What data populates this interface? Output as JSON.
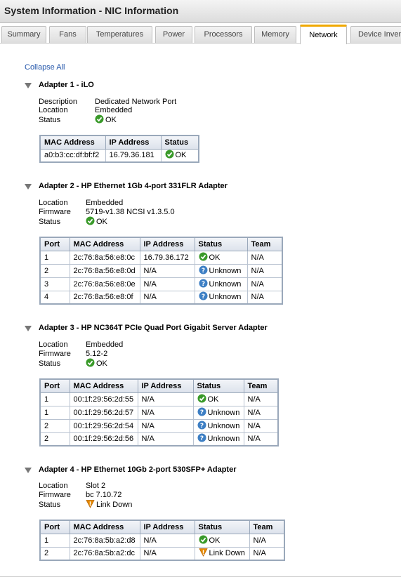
{
  "title": "System Information - NIC Information",
  "tabs": [
    "Summary",
    "Fans",
    "Temperatures",
    "Power",
    "Processors",
    "Memory",
    "Network",
    "Device Inventory"
  ],
  "active_tab": "Network",
  "collapse_all": "Collapse All",
  "labels": {
    "description": "Description",
    "location": "Location",
    "firmware": "Firmware",
    "status": "Status"
  },
  "columns": {
    "port": "Port",
    "mac": "MAC Address",
    "ip": "IP Address",
    "status": "Status",
    "team": "Team"
  },
  "colors": {
    "ok": "#3a9a2a",
    "unknown": "#3d7fc4",
    "warning": "#e88a00",
    "tab_accent": "#f0a800"
  },
  "adapters": [
    {
      "title": "Adapter 1 - iLO",
      "description": "Dedicated Network Port",
      "location": "Embedded",
      "status": "OK",
      "rows": [
        {
          "mac": "a0:b3:cc:df:bf:f2",
          "ip": "16.79.36.181",
          "status": "OK"
        }
      ]
    },
    {
      "title": "Adapter 2 - HP Ethernet 1Gb 4-port 331FLR Adapter",
      "location": "Embedded",
      "firmware": "5719-v1.38 NCSI v1.3.5.0",
      "status": "OK",
      "rows": [
        {
          "port": "1",
          "mac": "2c:76:8a:56:e8:0c",
          "ip": "16.79.36.172",
          "status": "OK",
          "team": "N/A"
        },
        {
          "port": "2",
          "mac": "2c:76:8a:56:e8:0d",
          "ip": "N/A",
          "status": "Unknown",
          "team": "N/A"
        },
        {
          "port": "3",
          "mac": "2c:76:8a:56:e8:0e",
          "ip": "N/A",
          "status": "Unknown",
          "team": "N/A"
        },
        {
          "port": "4",
          "mac": "2c:76:8a:56:e8:0f",
          "ip": "N/A",
          "status": "Unknown",
          "team": "N/A"
        }
      ]
    },
    {
      "title": "Adapter 3 - HP NC364T PCIe Quad Port Gigabit Server Adapter",
      "location": "Embedded",
      "firmware": "5.12-2",
      "status": "OK",
      "rows": [
        {
          "port": "1",
          "mac": "00:1f:29:56:2d:55",
          "ip": "N/A",
          "status": "OK",
          "team": "N/A"
        },
        {
          "port": "1",
          "mac": "00:1f:29:56:2d:57",
          "ip": "N/A",
          "status": "Unknown",
          "team": "N/A"
        },
        {
          "port": "2",
          "mac": "00:1f:29:56:2d:54",
          "ip": "N/A",
          "status": "Unknown",
          "team": "N/A"
        },
        {
          "port": "2",
          "mac": "00:1f:29:56:2d:56",
          "ip": "N/A",
          "status": "Unknown",
          "team": "N/A"
        }
      ]
    },
    {
      "title": "Adapter 4 - HP Ethernet 10Gb 2-port 530SFP+ Adapter",
      "location": "Slot 2",
      "firmware": "bc 7.10.72",
      "status": "Link Down",
      "rows": [
        {
          "port": "1",
          "mac": "2c:76:8a:5b:a2:d8",
          "ip": "N/A",
          "status": "OK",
          "team": "N/A"
        },
        {
          "port": "2",
          "mac": "2c:76:8a:5b:a2:dc",
          "ip": "N/A",
          "status": "Link Down",
          "team": "N/A"
        }
      ]
    }
  ]
}
